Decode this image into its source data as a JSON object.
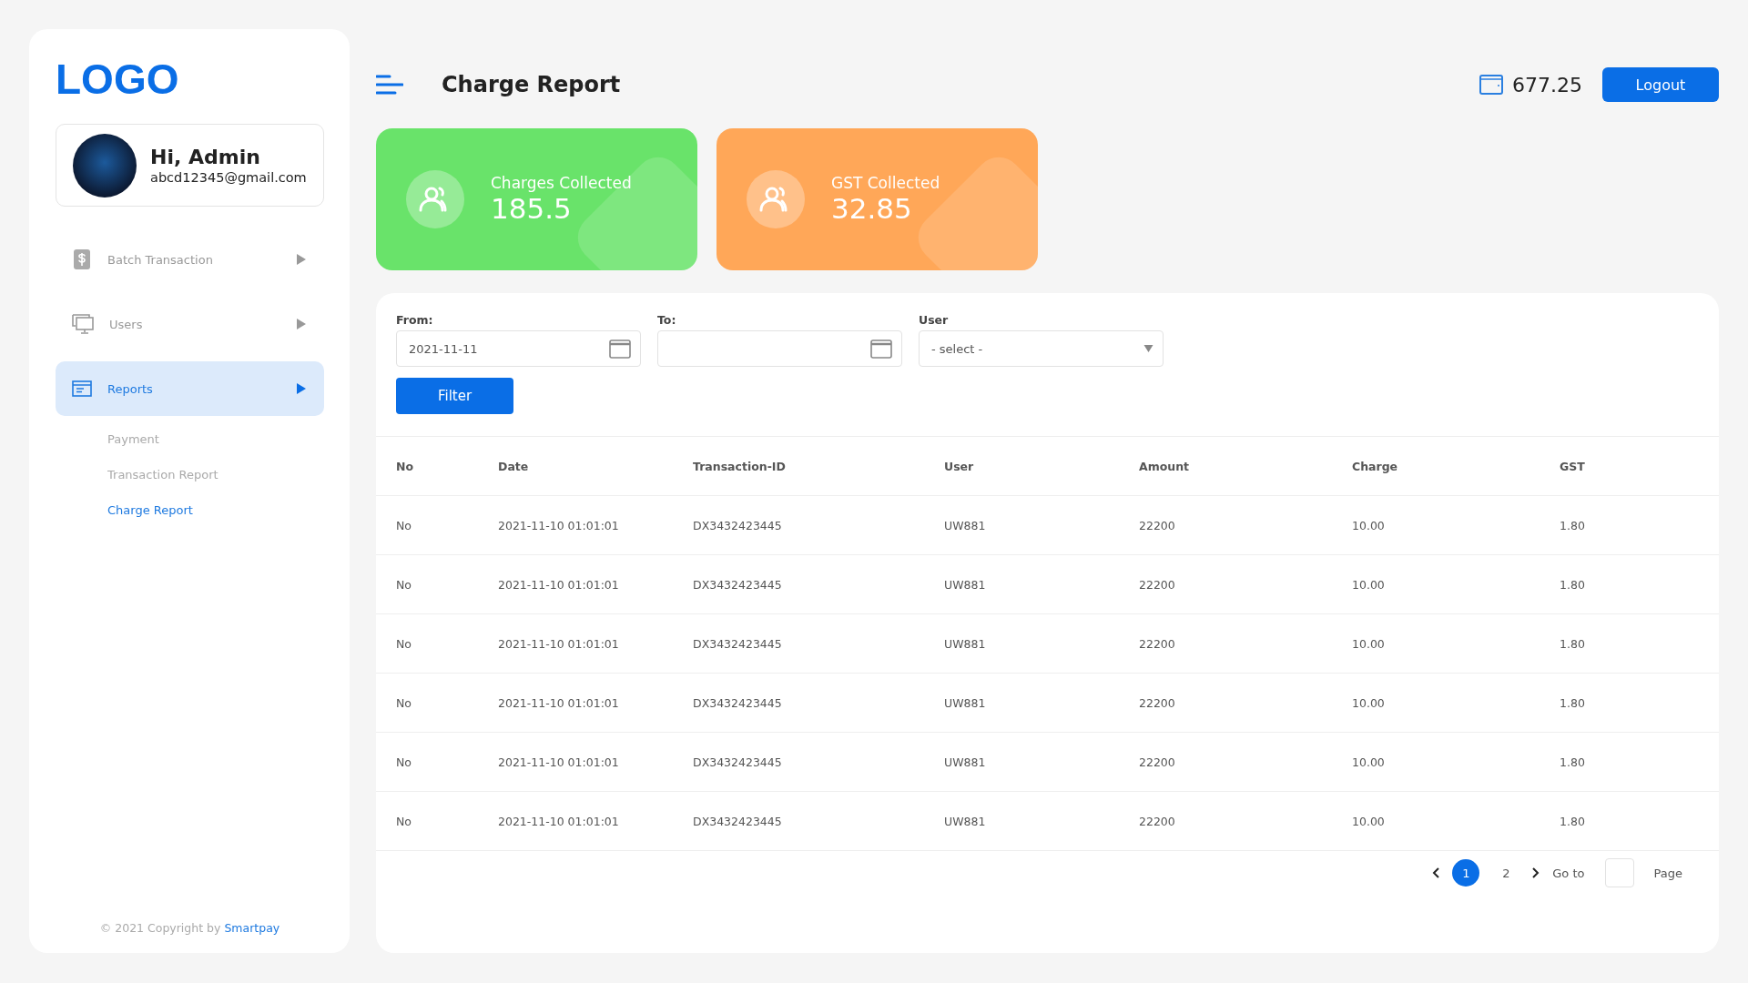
{
  "sidebar": {
    "logo": "LOGO",
    "profile": {
      "greeting": "Hi, Admin",
      "email": "abcd12345@gmail.com"
    },
    "items": [
      {
        "label": "Batch Transaction",
        "selected": false
      },
      {
        "label": "Users",
        "selected": false
      },
      {
        "label": "Reports",
        "selected": true,
        "children": [
          {
            "label": "Payment",
            "selected": false
          },
          {
            "label": "Transaction Report",
            "selected": false
          },
          {
            "label": "Charge Report",
            "selected": true
          }
        ]
      }
    ],
    "footer": {
      "text": "© 2021 Copyright by",
      "link": "Smartpay"
    }
  },
  "header": {
    "title": "Charge Report",
    "balance": "677.25",
    "logout": "Logout"
  },
  "cards": [
    {
      "label": "Charges Collected",
      "value": "185.5",
      "color": "#69e36a"
    },
    {
      "label": "GST Collected",
      "value": "32.85",
      "color": "#ffa758"
    }
  ],
  "filters": {
    "from": {
      "label": "From:",
      "value": "2021-11-11"
    },
    "to": {
      "label": "To:"
    },
    "user": {
      "label": "User",
      "value": "- select -"
    },
    "button": "Filter"
  },
  "table": {
    "columns": [
      "No",
      "Date",
      "Transaction-ID",
      "User",
      "Amount",
      "Charge",
      "GST"
    ],
    "rows": [
      [
        "No",
        "2021-11-10 01:01:01",
        "DX3432423445",
        "UW881",
        "22200",
        "10.00",
        "1.80"
      ],
      [
        "No",
        "2021-11-10 01:01:01",
        "DX3432423445",
        "UW881",
        "22200",
        "10.00",
        "1.80"
      ],
      [
        "No",
        "2021-11-10 01:01:01",
        "DX3432423445",
        "UW881",
        "22200",
        "10.00",
        "1.80"
      ],
      [
        "No",
        "2021-11-10 01:01:01",
        "DX3432423445",
        "UW881",
        "22200",
        "10.00",
        "1.80"
      ],
      [
        "No",
        "2021-11-10 01:01:01",
        "DX3432423445",
        "UW881",
        "22200",
        "10.00",
        "1.80"
      ],
      [
        "No",
        "2021-11-10 01:01:01",
        "DX3432423445",
        "UW881",
        "22200",
        "10.00",
        "1.80"
      ]
    ]
  },
  "pagination": {
    "pages": [
      {
        "label": "1",
        "selected": true
      },
      {
        "label": "2",
        "selected": false
      }
    ],
    "goto": "Go to",
    "page": "Page"
  }
}
